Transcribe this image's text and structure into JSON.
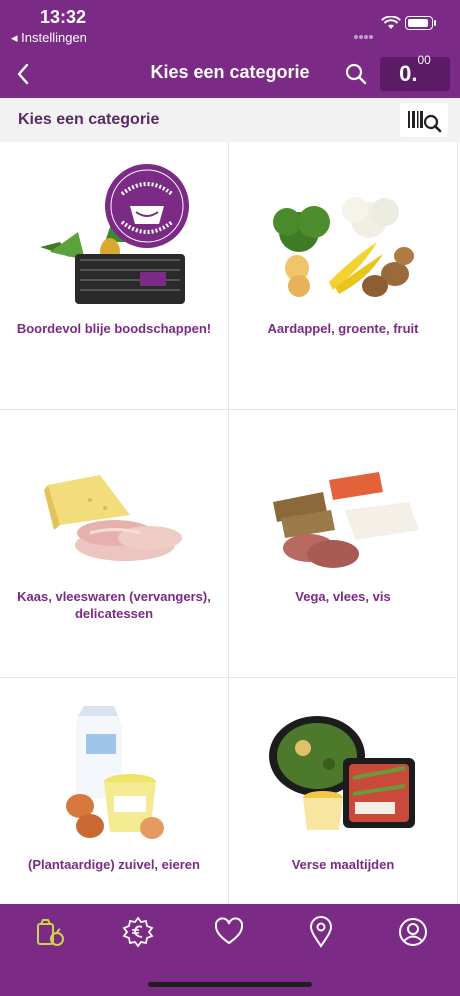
{
  "status_bar": {
    "time": "13:32",
    "back_app": "◂ Instellingen"
  },
  "nav": {
    "title": "Kies een categorie",
    "cart_amount": "0.",
    "cart_decimals": "00"
  },
  "subheader": {
    "label": "Kies een categorie"
  },
  "badge": {
    "line1": "boordevol blije",
    "line2": "boodschappen"
  },
  "categories": [
    {
      "label": "Boordevol blije boodschappen!"
    },
    {
      "label": "Aardappel, groente, fruit"
    },
    {
      "label": "Kaas, vleeswaren (vervangers), delicatessen"
    },
    {
      "label": "Vega, vlees, vis"
    },
    {
      "label": "(Plantaardige) zuivel, eieren"
    },
    {
      "label": "Verse maaltijden"
    }
  ],
  "tabs": [
    {
      "icon": "groceries-icon",
      "active": true
    },
    {
      "icon": "euro-offer-icon",
      "active": false
    },
    {
      "icon": "heart-icon",
      "active": false
    },
    {
      "icon": "location-pin-icon",
      "active": false
    },
    {
      "icon": "account-icon",
      "active": false
    }
  ],
  "colors": {
    "brand": "#7b2a86",
    "cart": "#5c1a67",
    "active_tab": "#c7d64a"
  }
}
